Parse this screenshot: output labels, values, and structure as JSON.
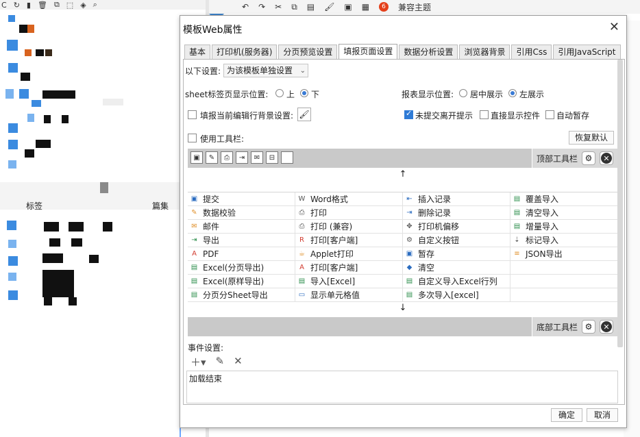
{
  "background": {
    "left_toolbar_glyphs": [
      "C",
      "↻",
      "▮",
      "🗑",
      "⧉",
      "⬚",
      "◈",
      "⌕"
    ],
    "right_toolbar": {
      "badge": "6",
      "label": "兼容主题"
    },
    "left_panel_text": {
      "item_a": "标签",
      "item_b": "篇集"
    }
  },
  "dialog": {
    "title": "模板Web属性",
    "close": "✕",
    "tabs": [
      "基本",
      "打印机(服务器)",
      "分页预览设置",
      "填报页面设置",
      "数据分析设置",
      "浏览器背景",
      "引用Css",
      "引用JavaScript"
    ],
    "active_tab_index": 3
  },
  "settings": {
    "apply_label": "以下设置:",
    "apply_value": "为该模板单独设置",
    "sheet_pos_label": "sheet标签页显示位置:",
    "sheet_pos_options": [
      "上",
      "下"
    ],
    "sheet_pos_selected": "下",
    "report_pos_label": "报表显示位置:",
    "report_pos_options": [
      "居中展示",
      "左展示"
    ],
    "report_pos_selected": "左展示",
    "fill_bg_label": "填报当前编辑行背景设置:",
    "leave_prompt_label": "未提交离开提示",
    "direct_show_label": "直接显示控件",
    "auto_save_label": "自动暂存",
    "use_toolbar_label": "使用工具栏:",
    "restore_default": "恢复默认"
  },
  "toolbar_editor": {
    "top_label": "顶部工具栏",
    "bottom_label": "底部工具栏",
    "top_icons": [
      "save-icon",
      "edit-icon",
      "print-icon",
      "export-icon",
      "mail-icon",
      "record-icon",
      "blank-icon"
    ],
    "grid": [
      [
        {
          "icon": "submit-icon",
          "text": "提交"
        },
        {
          "icon": "word-icon",
          "text": "Word格式"
        },
        {
          "icon": "insert-row-icon",
          "text": "插入记录"
        },
        {
          "icon": "excel-icon",
          "text": "覆盖导入"
        }
      ],
      [
        {
          "icon": "validate-icon",
          "text": "数据校验"
        },
        {
          "icon": "printer-icon",
          "text": "打印"
        },
        {
          "icon": "delete-row-icon",
          "text": "删除记录"
        },
        {
          "icon": "excel-icon",
          "text": "清空导入"
        }
      ],
      [
        {
          "icon": "mail-icon",
          "text": "邮件"
        },
        {
          "icon": "printer-icon",
          "text": "打印 (兼容)"
        },
        {
          "icon": "move-icon",
          "text": "打印机偏移"
        },
        {
          "icon": "excel-icon",
          "text": "增量导入"
        }
      ],
      [
        {
          "icon": "export-icon",
          "text": "导出"
        },
        {
          "icon": "client-print-icon",
          "text": "打印[客户端]"
        },
        {
          "icon": "gear-icon",
          "text": "自定义按钮"
        },
        {
          "icon": "mark-import-icon",
          "text": "标记导入"
        }
      ],
      [
        {
          "icon": "pdf-icon",
          "text": "PDF"
        },
        {
          "icon": "applet-icon",
          "text": "Applet打印"
        },
        {
          "icon": "pause-save-icon",
          "text": "暂存"
        },
        {
          "icon": "json-icon",
          "text": "JSON导出"
        }
      ],
      [
        {
          "icon": "excel-icon",
          "text": "Excel(分页导出)"
        },
        {
          "icon": "pdf-print-icon",
          "text": "打印[客户端]"
        },
        {
          "icon": "eraser-icon",
          "text": "清空"
        },
        {
          "icon": "",
          "text": ""
        }
      ],
      [
        {
          "icon": "excel-icon",
          "text": "Excel(原样导出)"
        },
        {
          "icon": "excel-icon",
          "text": "导入[Excel]"
        },
        {
          "icon": "excel-icon",
          "text": "自定义导入Excel行列"
        },
        {
          "icon": "",
          "text": ""
        }
      ],
      [
        {
          "icon": "excel-icon",
          "text": "分页分Sheet导出"
        },
        {
          "icon": "cell-icon",
          "text": "显示单元格值"
        },
        {
          "icon": "excel-icon",
          "text": "多次导入[excel]"
        },
        {
          "icon": "",
          "text": ""
        }
      ]
    ]
  },
  "events": {
    "label": "事件设置:",
    "items": [
      "加载结束"
    ]
  },
  "footer": {
    "ok": "确定",
    "cancel": "取消"
  }
}
